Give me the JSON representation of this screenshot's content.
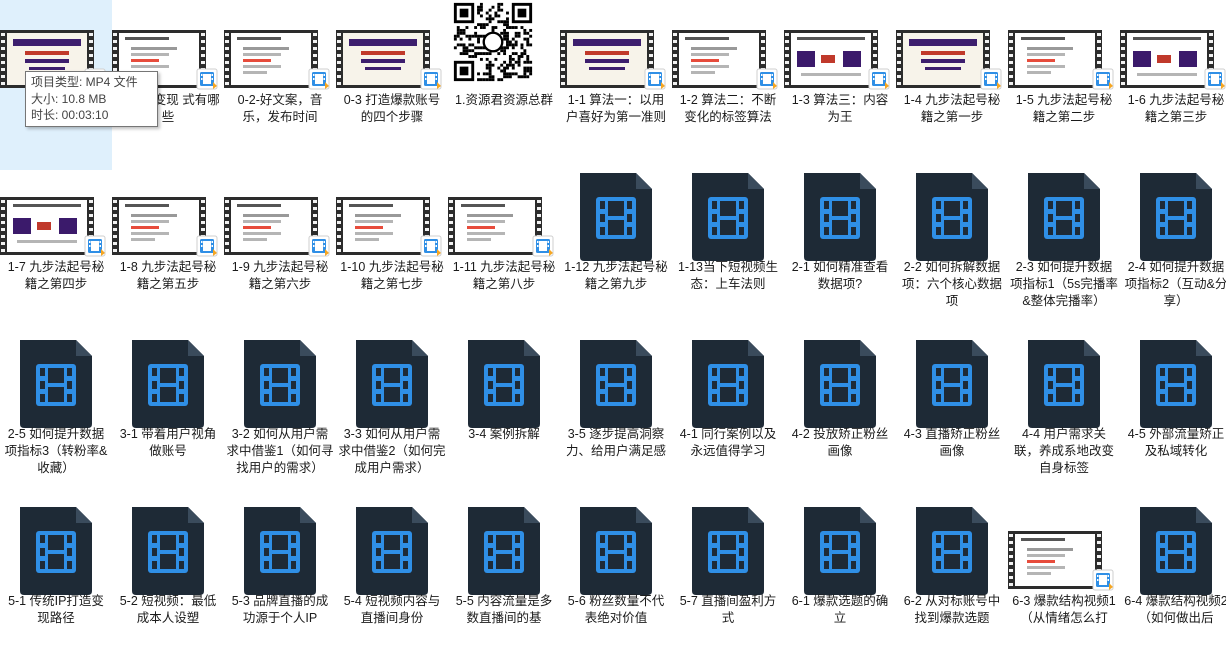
{
  "tooltip": {
    "type": "项目类型: MP4 文件",
    "size": "大小: 10.8 MB",
    "duration": "时长: 00:03:10"
  },
  "colors": {
    "file_icon_body": "#1e2a36",
    "file_icon_glyph": "#2f8fe6",
    "selection_bg": "#dff0fc"
  },
  "items": [
    {
      "label": "0-",
      "thumb": "film",
      "style": "title",
      "selected": true
    },
    {
      "label": "短视频变现\n式有哪些",
      "thumb": "film",
      "style": "doc"
    },
    {
      "label": "0-2-好文案，音乐，发布时间",
      "thumb": "film",
      "style": "doc"
    },
    {
      "label": "0-3 打造爆款账号的四个步骤",
      "thumb": "film",
      "style": "title"
    },
    {
      "label": "1.资源君资源总群",
      "thumb": "qr"
    },
    {
      "label": "1-1 算法一：以用户喜好为第一准则",
      "thumb": "film",
      "style": "title"
    },
    {
      "label": "1-2 算法二：不断变化的标签算法",
      "thumb": "film",
      "style": "doc"
    },
    {
      "label": "1-3 算法三：内容为王",
      "thumb": "film",
      "style": "diagram"
    },
    {
      "label": "1-4 九步法起号秘籍之第一步",
      "thumb": "film",
      "style": "title"
    },
    {
      "label": "1-5 九步法起号秘籍之第二步",
      "thumb": "film",
      "style": "doc"
    },
    {
      "label": "1-6 九步法起号秘籍之第三步",
      "thumb": "film",
      "style": "diagram"
    },
    {
      "label": "1-7 九步法起号秘籍之第四步",
      "thumb": "film",
      "style": "diagram"
    },
    {
      "label": "1-8 九步法起号秘籍之第五步",
      "thumb": "film",
      "style": "doc"
    },
    {
      "label": "1-9 九步法起号秘籍之第六步",
      "thumb": "film",
      "style": "doc"
    },
    {
      "label": "1-10 九步法起号秘籍之第七步",
      "thumb": "film",
      "style": "doc"
    },
    {
      "label": "1-11 九步法起号秘籍之第八步",
      "thumb": "film",
      "style": "doc"
    },
    {
      "label": "1-12 九步法起号秘籍之第九步",
      "thumb": "video"
    },
    {
      "label": "1-13当下短视频生态：上车法则",
      "thumb": "video"
    },
    {
      "label": "2-1 如何精准查看数据项?",
      "thumb": "video"
    },
    {
      "label": "2-2 如何拆解数据项：六个核心数据项",
      "thumb": "video"
    },
    {
      "label": "2-3 如何提升数据项指标1（5s完播率&整体完播率）",
      "thumb": "video"
    },
    {
      "label": "2-4 如何提升数据项指标2（互动&分享）",
      "thumb": "video"
    },
    {
      "label": "2-5 如何提升数据项指标3（转粉率&收藏）",
      "thumb": "video"
    },
    {
      "label": "3-1 带着用户视角做账号",
      "thumb": "video"
    },
    {
      "label": "3-2 如何从用户需求中借鉴1（如何寻找用户的需求）",
      "thumb": "video"
    },
    {
      "label": "3-3 如何从用户需求中借鉴2（如何完成用户需求）",
      "thumb": "video"
    },
    {
      "label": "3-4 案例拆解",
      "thumb": "video"
    },
    {
      "label": "3-5 逐步提高洞察力、给用户满足感",
      "thumb": "video"
    },
    {
      "label": "4-1 同行案例以及永远值得学习",
      "thumb": "video"
    },
    {
      "label": "4-2 投放矫正粉丝画像",
      "thumb": "video"
    },
    {
      "label": "4-3 直播矫正粉丝画像",
      "thumb": "video"
    },
    {
      "label": "4-4 用户需求关联，养成系地改变自身标签",
      "thumb": "video"
    },
    {
      "label": "4-5 外部流量矫正及私域转化",
      "thumb": "video"
    },
    {
      "label": "5-1 传统IP打造变现路径",
      "thumb": "video"
    },
    {
      "label": "5-2 短视频：最低成本人设塑",
      "thumb": "video"
    },
    {
      "label": "5-3 品牌直播的成功源于个人IP",
      "thumb": "video"
    },
    {
      "label": "5-4 短视频内容与直播间身份",
      "thumb": "video"
    },
    {
      "label": "5-5 内容流量是多数直播间的基",
      "thumb": "video"
    },
    {
      "label": "5-6 粉丝数量不代表绝对价值",
      "thumb": "video"
    },
    {
      "label": "5-7 直播间盈利方式",
      "thumb": "video"
    },
    {
      "label": "6-1 爆款选题的确立",
      "thumb": "video"
    },
    {
      "label": "6-2 从对标账号中找到爆款选题",
      "thumb": "video"
    },
    {
      "label": "6-3 爆款结构视频1（从情绪怎么打",
      "thumb": "film",
      "style": "doc"
    },
    {
      "label": "6-4 爆款结构视频2（如何做出后",
      "thumb": "video"
    }
  ]
}
